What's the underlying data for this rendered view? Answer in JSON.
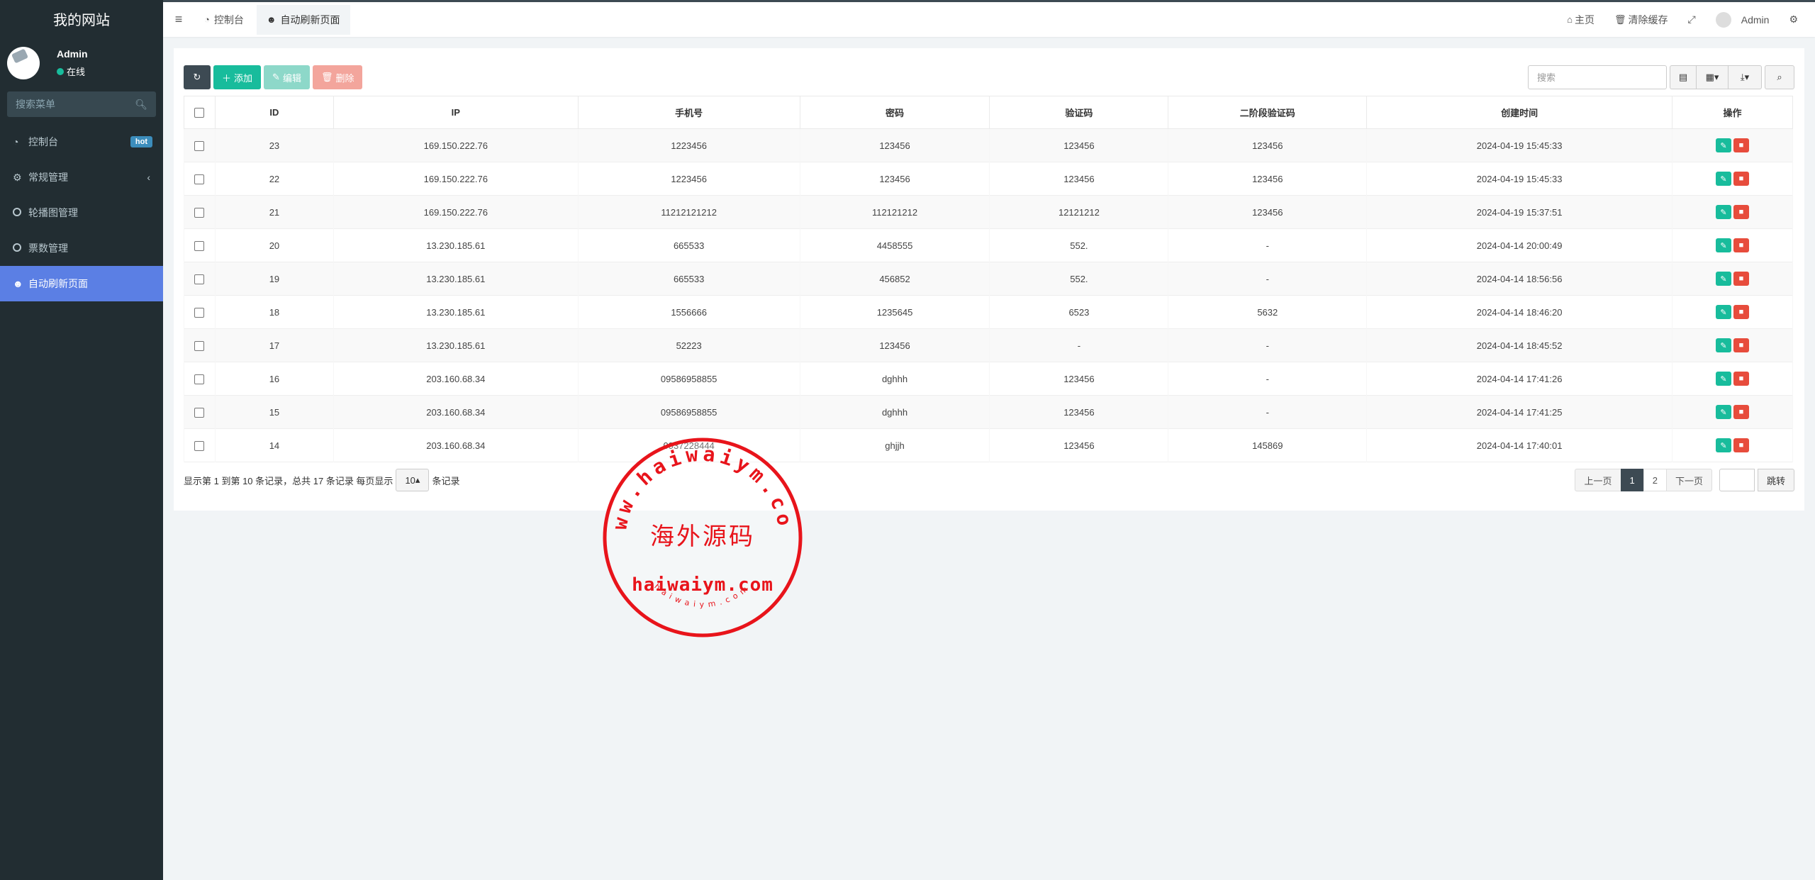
{
  "sidebar": {
    "site_title": "我的网站",
    "user": {
      "name": "Admin",
      "status": "在线"
    },
    "search_placeholder": "搜索菜单",
    "menu": [
      {
        "label": "控制台",
        "icon": "dashboard-icon",
        "badge": "hot"
      },
      {
        "label": "常规管理",
        "icon": "cogs-icon",
        "has_submenu": true
      },
      {
        "label": "轮播图管理",
        "icon": "circle-icon"
      },
      {
        "label": "票数管理",
        "icon": "circle-icon"
      },
      {
        "label": "自动刷新页面",
        "icon": "users-icon",
        "active": true
      }
    ]
  },
  "header": {
    "tabs": [
      {
        "label": "控制台",
        "icon": "dashboard-icon"
      },
      {
        "label": "自动刷新页面",
        "icon": "users-icon",
        "active": true
      }
    ],
    "right": {
      "home": "主页",
      "clear_cache": "清除缓存",
      "user": "Admin"
    }
  },
  "toolbar": {
    "add": "添加",
    "edit": "编辑",
    "delete": "删除",
    "search_placeholder": "搜索"
  },
  "table": {
    "columns": [
      "ID",
      "IP",
      "手机号",
      "密码",
      "验证码",
      "二阶段验证码",
      "创建时间",
      "操作"
    ],
    "rows": [
      [
        "23",
        "169.150.222.76",
        "1223456",
        "123456",
        "123456",
        "123456",
        "2024-04-19 15:45:33"
      ],
      [
        "22",
        "169.150.222.76",
        "1223456",
        "123456",
        "123456",
        "123456",
        "2024-04-19 15:45:33"
      ],
      [
        "21",
        "169.150.222.76",
        "11212121212",
        "112121212",
        "12121212",
        "123456",
        "2024-04-19 15:37:51"
      ],
      [
        "20",
        "13.230.185.61",
        "665533",
        "4458555",
        "552.",
        "-",
        "2024-04-14 20:00:49"
      ],
      [
        "19",
        "13.230.185.61",
        "665533",
        "456852",
        "552.",
        "-",
        "2024-04-14 18:56:56"
      ],
      [
        "18",
        "13.230.185.61",
        "1556666",
        "1235645",
        "6523",
        "5632",
        "2024-04-14 18:46:20"
      ],
      [
        "17",
        "13.230.185.61",
        "52223",
        "123456",
        "-",
        "-",
        "2024-04-14 18:45:52"
      ],
      [
        "16",
        "203.160.68.34",
        "09586958855",
        "dghhh",
        "123456",
        "-",
        "2024-04-14 17:41:26"
      ],
      [
        "15",
        "203.160.68.34",
        "09586958855",
        "dghhh",
        "123456",
        "-",
        "2024-04-14 17:41:25"
      ],
      [
        "14",
        "203.160.68.34",
        "0937228444",
        "ghjjh",
        "123456",
        "145869",
        "2024-04-14 17:40:01"
      ]
    ]
  },
  "footer": {
    "info_before": "显示第 1 到第 10 条记录，总共 17 条记录 每页显示",
    "page_size": "10",
    "info_after": "条记录",
    "prev": "上一页",
    "pages": [
      "1",
      "2"
    ],
    "next": "下一页",
    "go": "跳转"
  },
  "watermark": {
    "url_ring": "www.haiwaiym.com",
    "center": "海外源码",
    "domain": "haiwaiym.com",
    "small": "haiwaiym.com"
  }
}
